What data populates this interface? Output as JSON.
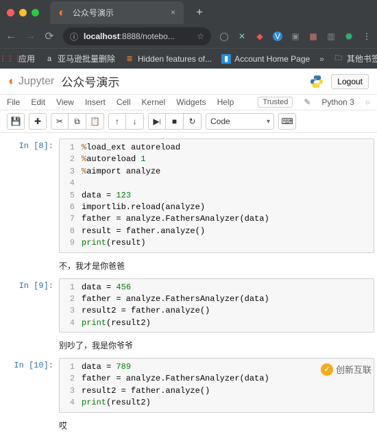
{
  "browser": {
    "tab_title": "公众号演示",
    "url_host": "localhost",
    "url_rest": ":8888/notebo...",
    "bookmarks": {
      "apps": "应用",
      "b1": "亚马逊批量删除",
      "b2": "Hidden features of...",
      "b3": "Account Home Page",
      "more": "»",
      "other": "其他书签"
    }
  },
  "jupyter": {
    "brand": "Jupyter",
    "title": "公众号演示",
    "logout": "Logout",
    "kernel": "Python 3",
    "trusted": "Trusted",
    "menus": [
      "File",
      "Edit",
      "View",
      "Insert",
      "Cell",
      "Kernel",
      "Widgets",
      "Help"
    ]
  },
  "toolbar": {
    "celltype": "Code"
  },
  "cells": [
    {
      "prompt": "In [8]:",
      "lines": [
        {
          "n": "1",
          "raw": "%load_ext autoreload"
        },
        {
          "n": "2",
          "raw": "%autoreload 1"
        },
        {
          "n": "3",
          "raw": "%aimport analyze"
        },
        {
          "n": "4",
          "raw": ""
        },
        {
          "n": "5",
          "raw": "data = 123"
        },
        {
          "n": "6",
          "raw": "importlib.reload(analyze)"
        },
        {
          "n": "7",
          "raw": "father = analyze.FathersAnalyzer(data)"
        },
        {
          "n": "8",
          "raw": "result = father.analyze()"
        },
        {
          "n": "9",
          "raw": "print(result)"
        }
      ],
      "output": "不，我才是你爸爸"
    },
    {
      "prompt": "In [9]:",
      "lines": [
        {
          "n": "1",
          "raw": "data = 456"
        },
        {
          "n": "2",
          "raw": "father = analyze.FathersAnalyzer(data)"
        },
        {
          "n": "3",
          "raw": "result2 = father.analyze()"
        },
        {
          "n": "4",
          "raw": "print(result2)"
        }
      ],
      "output": "别吵了，我是你爷爷"
    },
    {
      "prompt": "In [10]:",
      "lines": [
        {
          "n": "1",
          "raw": "data = 789"
        },
        {
          "n": "2",
          "raw": "father = analyze.FathersAnalyzer(data)"
        },
        {
          "n": "3",
          "raw": "result2 = father.analyze()"
        },
        {
          "n": "4",
          "raw": "print(result2)"
        }
      ],
      "output": "哎"
    }
  ],
  "watermark": "创新互联"
}
